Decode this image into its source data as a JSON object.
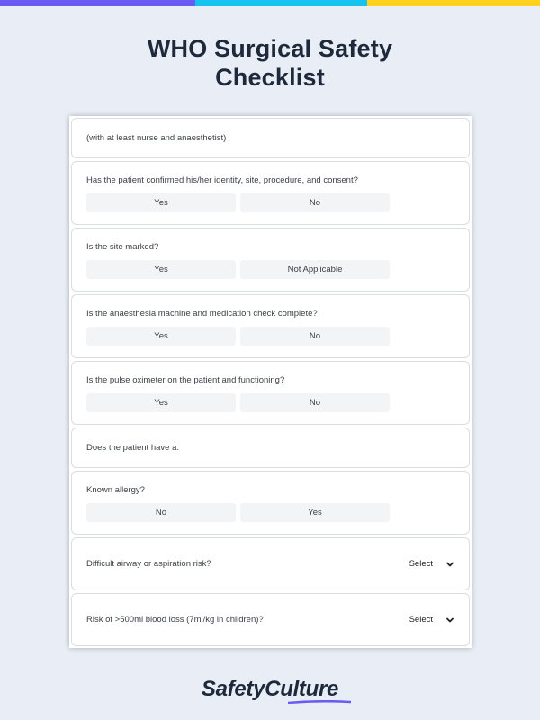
{
  "accent_colors": {
    "bar_1": "#6a5cf2",
    "bar_2": "#16c3f0",
    "bar_3": "#ffd21f",
    "underline": "#6a5cf2"
  },
  "title_line1": "WHO Surgical Safety",
  "title_line2": "Checklist",
  "note": "(with at least nurse and anaesthetist)",
  "questions": [
    {
      "text": "Has the patient confirmed his/her identity, site, procedure, and consent?",
      "options": [
        "Yes",
        "No"
      ]
    },
    {
      "text": "Is the site marked?",
      "options": [
        "Yes",
        "Not Applicable"
      ]
    },
    {
      "text": "Is the anaesthesia machine and medication check complete?",
      "options": [
        "Yes",
        "No"
      ]
    },
    {
      "text": "Is the pulse oximeter on the patient and functioning?",
      "options": [
        "Yes",
        "No"
      ]
    }
  ],
  "section_header": "Does the patient have a:",
  "allergy": {
    "text": "Known allergy?",
    "options": [
      "No",
      "Yes"
    ]
  },
  "select_questions": [
    {
      "text": "Difficult airway or aspiration risk?",
      "select_label": "Select",
      "icon": "chevron-down-icon"
    },
    {
      "text": "Risk of >500ml blood loss (7ml/kg in children)?",
      "select_label": "Select",
      "icon": "chevron-down-icon"
    }
  ],
  "brand": {
    "part1": "Safety",
    "part2": "Culture"
  }
}
